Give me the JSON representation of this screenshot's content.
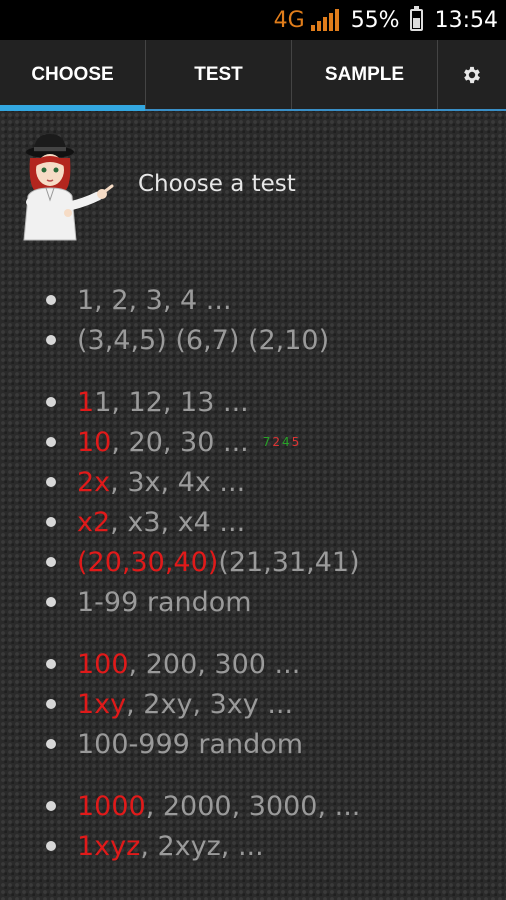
{
  "status": {
    "network": "4G",
    "battery": "55%",
    "time": "13:54"
  },
  "tabs": [
    {
      "label": "CHOOSE",
      "active": true
    },
    {
      "label": "TEST",
      "active": false
    },
    {
      "label": "SAMPLE",
      "active": false
    }
  ],
  "header": {
    "title": "Choose a test"
  },
  "groups": [
    {
      "items": [
        {
          "highlight": "",
          "rest": "1, 2, 3, 4 ..."
        },
        {
          "highlight": "",
          "rest": "(3,4,5) (6,7) (2,10)"
        }
      ]
    },
    {
      "items": [
        {
          "highlight": "1",
          "rest": "1, 12, 13 ..."
        },
        {
          "highlight": "10",
          "rest": ", 20, 30 ...",
          "mini": [
            "7",
            "2",
            "4",
            "5"
          ]
        },
        {
          "highlight": "2x",
          "rest": ", 3x, 4x ..."
        },
        {
          "highlight": "x2",
          "rest": ", x3, x4 ..."
        },
        {
          "highlight": "(20,30,40)",
          "rest": " (21,31,41)"
        },
        {
          "highlight": "",
          "rest": "1-99 random"
        }
      ]
    },
    {
      "items": [
        {
          "highlight": "100",
          "rest": ", 200, 300 ..."
        },
        {
          "highlight": "1xy",
          "rest": ", 2xy, 3xy ..."
        },
        {
          "highlight": "",
          "rest": "100-999 random"
        }
      ]
    },
    {
      "items": [
        {
          "highlight": "1000",
          "rest": ", 2000, 3000, ..."
        },
        {
          "highlight": "1xyz",
          "rest": ", 2xyz, ..."
        }
      ]
    }
  ],
  "colors": {
    "highlight": "#e01a1a",
    "tab_indicator": "#33a7e0",
    "network": "#e07d1b"
  },
  "icons": {
    "settings": "gear-icon",
    "avatar": "girl-character-avatar"
  }
}
